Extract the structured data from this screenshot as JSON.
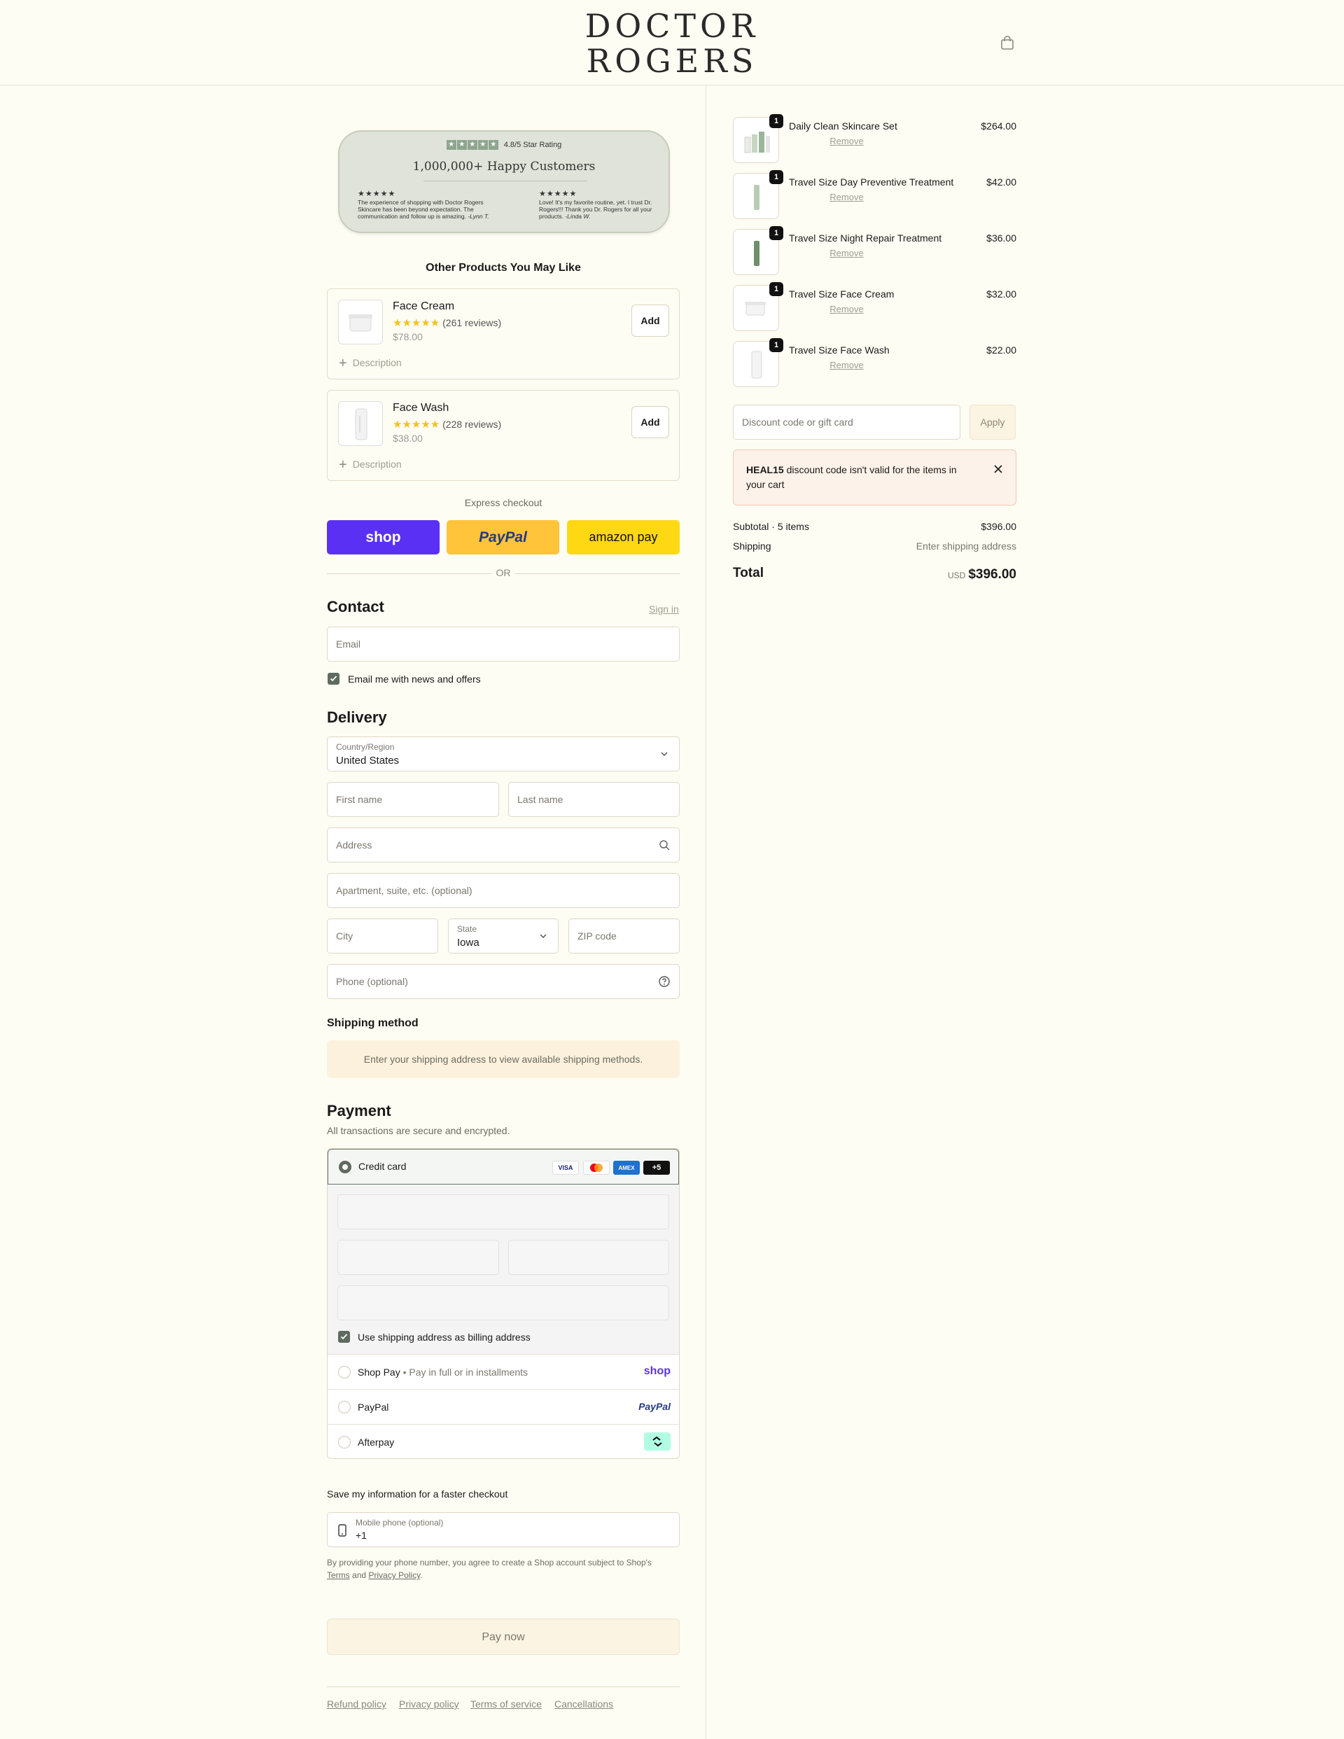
{
  "header": {
    "logo_line1": "DOCTOR",
    "logo_line2": "ROGERS",
    "cart_icon": "shopping-bag-icon"
  },
  "banner": {
    "rating": "4.8/5 Star Rating",
    "title": "1,000,000+ Happy Customers",
    "reviews": [
      {
        "stars": "★★★★★",
        "text": "The experience of shopping with Doctor Rogers Skincare has been beyond expectation. The communication and follow up is amazing.",
        "author": "-Lynn T."
      },
      {
        "stars": "★★★★★",
        "text": "Love! It's my favorite routine, yet. I trust Dr. Rogers!!! Thank you Dr. Rogers for all your products.",
        "author": "-Linda W."
      }
    ]
  },
  "upsell": {
    "heading": "Other Products You May Like",
    "products": [
      {
        "name": "Face Cream",
        "stars": "★★★★★",
        "reviews": "(261 reviews)",
        "price": "$78.00",
        "add_label": "Add",
        "description_label": "Description"
      },
      {
        "name": "Face Wash",
        "stars": "★★★★★",
        "reviews": "(228 reviews)",
        "price": "$38.00",
        "add_label": "Add",
        "description_label": "Description"
      }
    ]
  },
  "express": {
    "label": "Express checkout",
    "shop_label": "shop",
    "paypal_label": "PayPal",
    "amazon_label": "amazon pay",
    "or_label": "OR",
    "colors": {
      "shop": "#5a31f4",
      "paypal": "#ffc439",
      "amazon": "#ffd814"
    }
  },
  "contact": {
    "title": "Contact",
    "sign_in": "Sign in",
    "email_placeholder": "Email",
    "newsletter_label": "Email me with news and offers",
    "newsletter_checked": true
  },
  "delivery": {
    "title": "Delivery",
    "country_label": "Country/Region",
    "country_value": "United States",
    "first_name": "First name",
    "last_name": "Last name",
    "address": "Address",
    "apartment": "Apartment, suite, etc. (optional)",
    "city": "City",
    "state_label": "State",
    "state_value": "Iowa",
    "zip": "ZIP code",
    "phone": "Phone (optional)"
  },
  "shipping": {
    "title": "Shipping method",
    "notice": "Enter your shipping address to view available shipping methods."
  },
  "payment": {
    "title": "Payment",
    "subtitle": "All transactions are secure and encrypted.",
    "credit_card_label": "Credit card",
    "card_logos": [
      "VISA",
      "mastercard",
      "AMEX",
      "+5"
    ],
    "billing_same_label": "Use shipping address as billing address",
    "shop_pay_label": "Shop Pay",
    "shop_pay_sub": "Pay in full or in installments",
    "shop_pay_logo": "shop",
    "paypal_label": "PayPal",
    "paypal_logo": "PayPal",
    "afterpay_label": "Afterpay"
  },
  "save_info": {
    "title": "Save my information for a faster checkout",
    "phone_label": "Mobile phone (optional)",
    "phone_value": "+1",
    "disclaimer_1": "By providing your phone number, you agree to create a Shop account subject to Shop's",
    "terms": "Terms",
    "and": "and",
    "privacy": "Privacy Policy",
    "period": "."
  },
  "pay_now": "Pay now",
  "footer_links": [
    "Refund policy",
    "Privacy policy",
    "Terms of service",
    "Cancellations"
  ],
  "cart": {
    "items": [
      {
        "qty": "1",
        "name": "Daily Clean Skincare Set",
        "price": "$264.00",
        "remove": "Remove"
      },
      {
        "qty": "1",
        "name": "Travel Size Day Preventive Treatment",
        "price": "$42.00",
        "remove": "Remove"
      },
      {
        "qty": "1",
        "name": "Travel Size Night Repair Treatment",
        "price": "$36.00",
        "remove": "Remove"
      },
      {
        "qty": "1",
        "name": "Travel Size Face Cream",
        "price": "$32.00",
        "remove": "Remove"
      },
      {
        "qty": "1",
        "name": "Travel Size Face Wash",
        "price": "$22.00",
        "remove": "Remove"
      }
    ],
    "discount_placeholder": "Discount code or gift card",
    "apply_label": "Apply",
    "error_code": "HEAL15",
    "error_message": " discount code isn't valid for the items in your cart",
    "subtotal_label": "Subtotal · 5 items",
    "subtotal_value": "$396.00",
    "shipping_label": "Shipping",
    "shipping_value": "Enter shipping address",
    "total_label": "Total",
    "currency": "USD",
    "total_value": "$396.00"
  }
}
